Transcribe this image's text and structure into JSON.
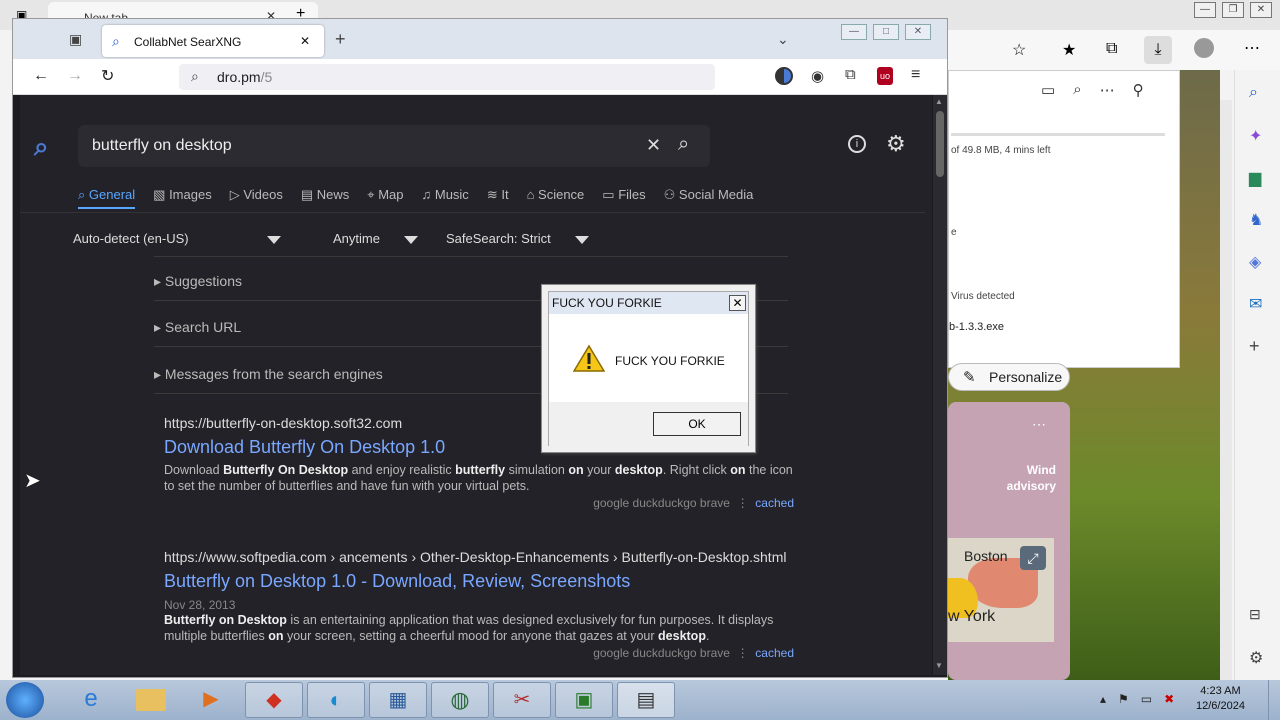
{
  "edge": {
    "tab_title": "New tab",
    "download_status": "of 49.8 MB, 4 mins left",
    "download_warning": "Virus detected",
    "download_file": "b-1.3.3.exe",
    "personalize_label": "Personalize",
    "weather_alert": "Wind advisory",
    "map_city1": "Boston",
    "map_city2": "w York"
  },
  "firefox": {
    "tab_title": "CollabNet SearXNG",
    "url_host": "dro.pm",
    "url_path": "/5"
  },
  "search": {
    "query": "butterfly on desktop",
    "categories": [
      {
        "label": "General",
        "icon": "search-icon"
      },
      {
        "label": "Images",
        "icon": "image-icon"
      },
      {
        "label": "Videos",
        "icon": "play-icon"
      },
      {
        "label": "News",
        "icon": "newspaper-icon"
      },
      {
        "label": "Map",
        "icon": "map-pin-icon"
      },
      {
        "label": "Music",
        "icon": "music-icon"
      },
      {
        "label": "It",
        "icon": "layers-icon"
      },
      {
        "label": "Science",
        "icon": "science-icon"
      },
      {
        "label": "Files",
        "icon": "files-icon"
      },
      {
        "label": "Social Media",
        "icon": "people-icon"
      }
    ],
    "filters": {
      "language": "Auto-detect (en-US)",
      "time": "Anytime",
      "safesearch": "SafeSearch: Strict"
    },
    "details": [
      "Suggestions",
      "Search URL",
      "Messages from the search engines"
    ],
    "results": [
      {
        "url": "https://butterfly-on-desktop.soft32.com",
        "title": "Download Butterfly On Desktop 1.0",
        "date": "",
        "snippet": "Download Butterfly On Desktop and enjoy realistic butterfly simulation on your desktop. Right click on the icon to set the number of butterflies and have fun with your virtual pets.",
        "engines": "google   duckduckgo   brave",
        "cached": "cached"
      },
      {
        "url": "https://www.softpedia.com › ancements › Other-Desktop-Enhancements › Butterfly-on-Desktop.shtml",
        "title": "Butterfly on Desktop 1.0 - Download, Review, Screenshots",
        "date": "Nov 28, 2013",
        "snippet": "Butterfly on Desktop is an entertaining application that was designed exclusively for fun purposes. It displays multiple butterflies on your screen, setting a cheerful mood for anyone that gazes at your desktop.",
        "engines": "google   duckduckgo   brave",
        "cached": "cached"
      }
    ]
  },
  "dialog": {
    "title": "FUCK YOU FORKIE",
    "message": "FUCK YOU FORKIE",
    "ok_label": "OK"
  },
  "taskbar": {
    "time": "4:23 AM",
    "date": "12/6/2024"
  }
}
